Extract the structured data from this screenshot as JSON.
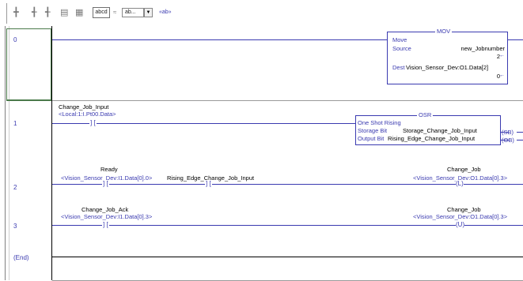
{
  "toolbar": {
    "icons": [
      "rung-icon",
      "branch-icon",
      "branch-level-icon",
      "box-icon",
      "box-branch-icon"
    ],
    "tag_box_label": "abcd",
    "insert_label": "ab...",
    "arrow_label": "▼",
    "nav_label": "«ab»"
  },
  "rungs": [
    {
      "number": "0",
      "instruction": {
        "name": "MOV",
        "title": "Move",
        "source_label": "Source",
        "source_value": "new_Jobnumber",
        "source_num": "2",
        "dest_label": "Dest",
        "dest_value": "Vision_Sensor_Dev:O1.Data[2]",
        "dest_num": "0"
      }
    },
    {
      "number": "1",
      "contact": {
        "name": "Change_Job_Input",
        "address": "<Local:1:I.Pt00.Data>"
      },
      "instruction": {
        "name": "OSR",
        "title": "One Shot Rising",
        "storage_label": "Storage Bit",
        "storage_value": "Storage_Change_Job_Input",
        "storage_tag": "(SB)",
        "output_label": "Output Bit",
        "output_value": "Rising_Edge_Change_Job_Input",
        "output_tag": "(OB)"
      }
    },
    {
      "number": "2",
      "contact1": {
        "name": "Ready",
        "address": "<Vision_Sensor_Dev:I1.Data[0].0>"
      },
      "contact2": {
        "name": "Rising_Edge_Change_Job_Input"
      },
      "coil": {
        "name": "Change_Job",
        "address": "<Vision_Sensor_Dev:O1.Data[0].3>",
        "symbol": "(L)"
      }
    },
    {
      "number": "3",
      "contact1": {
        "name": "Change_Job_Ack",
        "address": "<Vision_Sensor_Dev:I1.Data[0].3>"
      },
      "coil": {
        "name": "Change_Job",
        "address": "<Vision_Sensor_Dev:O1.Data[0].3>",
        "symbol": "(U)"
      }
    },
    {
      "number": "(End)"
    }
  ],
  "symbols": {
    "contact": "] ["
  },
  "colors": {
    "wire": "#3a3ab0",
    "selection": "#4a7a4a"
  }
}
